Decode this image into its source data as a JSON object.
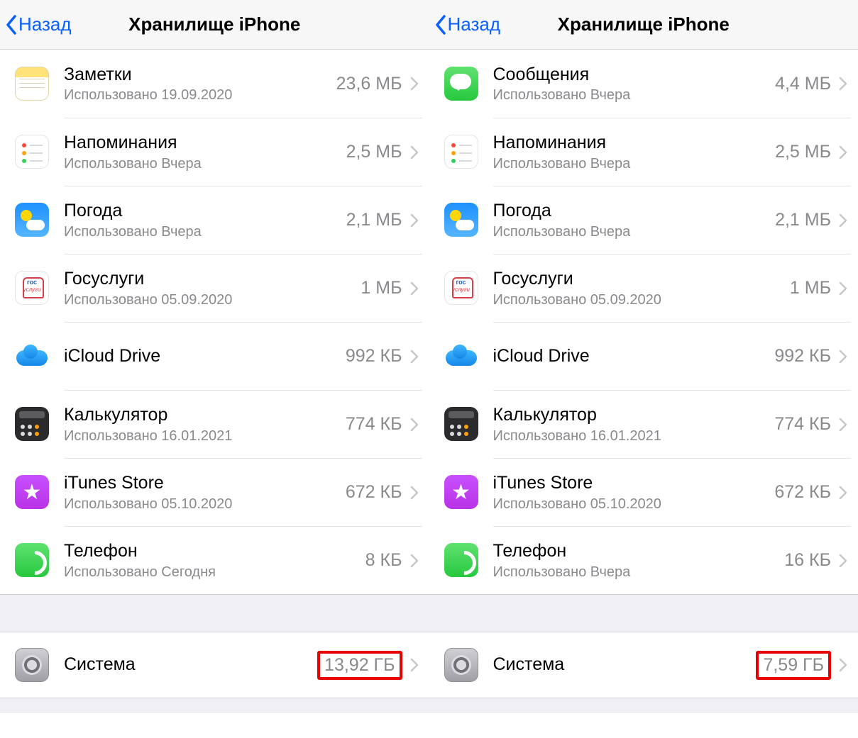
{
  "back_label": "Назад",
  "page_title": "Хранилище iPhone",
  "system_label": "Система",
  "used_prefix": "Использовано",
  "panels": [
    {
      "system_size": "13,92 ГБ",
      "rows": [
        {
          "icon": "notes",
          "name": "Заметки",
          "sub": "Использовано 19.09.2020",
          "size": "23,6 МБ"
        },
        {
          "icon": "rem",
          "name": "Напоминания",
          "sub": "Использовано Вчера",
          "size": "2,5 МБ"
        },
        {
          "icon": "weather",
          "name": "Погода",
          "sub": "Использовано Вчера",
          "size": "2,1 МБ"
        },
        {
          "icon": "gos",
          "name": "Госуслуги",
          "sub": "Использовано 05.09.2020",
          "size": "1 МБ"
        },
        {
          "icon": "icloud",
          "name": "iCloud Drive",
          "sub": "",
          "size": "992 КБ"
        },
        {
          "icon": "calc",
          "name": "Калькулятор",
          "sub": "Использовано 16.01.2021",
          "size": "774 КБ"
        },
        {
          "icon": "itunes",
          "name": "iTunes Store",
          "sub": "Использовано 05.10.2020",
          "size": "672 КБ"
        },
        {
          "icon": "phone",
          "name": "Телефон",
          "sub": "Использовано Сегодня",
          "size": "8 КБ"
        }
      ]
    },
    {
      "system_size": "7,59 ГБ",
      "rows": [
        {
          "icon": "msg",
          "name": "Сообщения",
          "sub": "Использовано Вчера",
          "size": "4,4 МБ"
        },
        {
          "icon": "rem",
          "name": "Напоминания",
          "sub": "Использовано Вчера",
          "size": "2,5 МБ"
        },
        {
          "icon": "weather",
          "name": "Погода",
          "sub": "Использовано Вчера",
          "size": "2,1 МБ"
        },
        {
          "icon": "gos",
          "name": "Госуслуги",
          "sub": "Использовано 05.09.2020",
          "size": "1 МБ"
        },
        {
          "icon": "icloud",
          "name": "iCloud Drive",
          "sub": "",
          "size": "992 КБ"
        },
        {
          "icon": "calc",
          "name": "Калькулятор",
          "sub": "Использовано 16.01.2021",
          "size": "774 КБ"
        },
        {
          "icon": "itunes",
          "name": "iTunes Store",
          "sub": "Использовано 05.10.2020",
          "size": "672 КБ"
        },
        {
          "icon": "phone",
          "name": "Телефон",
          "sub": "Использовано Вчера",
          "size": "16 КБ"
        }
      ]
    }
  ]
}
